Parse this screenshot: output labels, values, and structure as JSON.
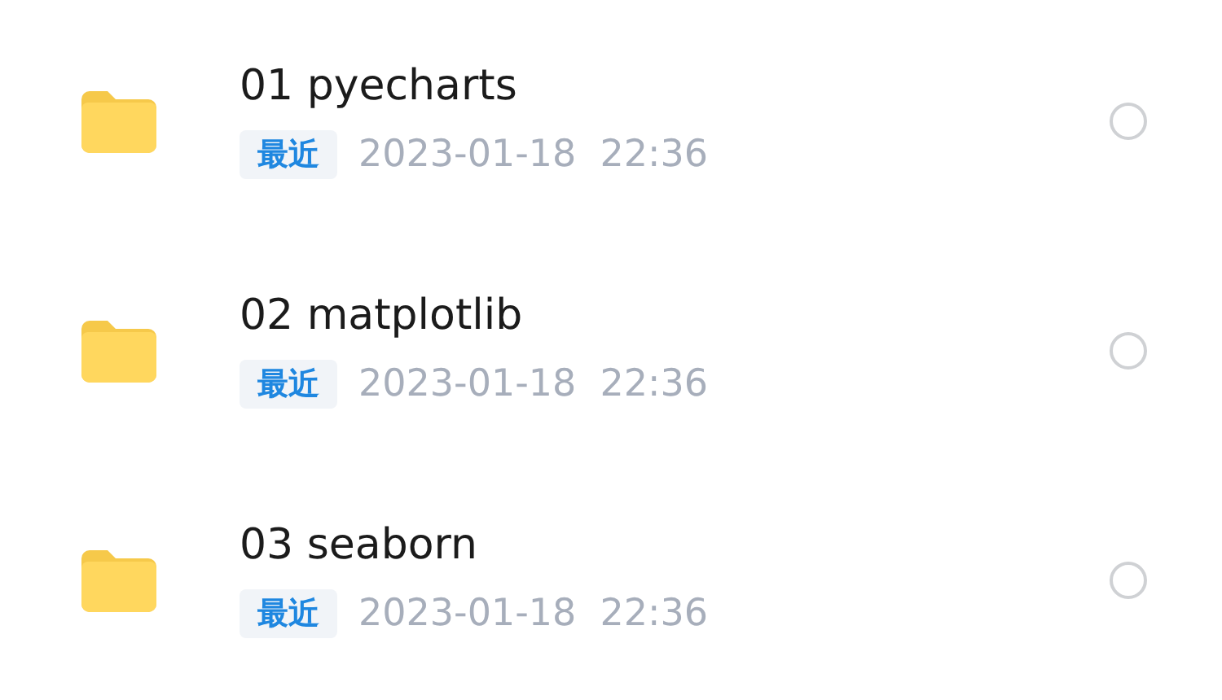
{
  "files": [
    {
      "name": "01 pyecharts",
      "tag": "最近",
      "modified": "2023-01-18  22:36",
      "selected": false
    },
    {
      "name": "02 matplotlib",
      "tag": "最近",
      "modified": "2023-01-18  22:36",
      "selected": false
    },
    {
      "name": "03 seaborn",
      "tag": "最近",
      "modified": "2023-01-18  22:36",
      "selected": false
    }
  ]
}
